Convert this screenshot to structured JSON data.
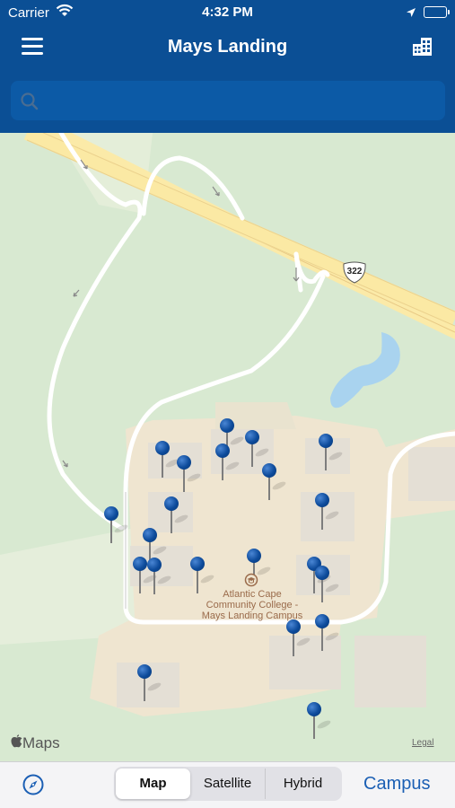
{
  "status_bar": {
    "carrier": "Carrier",
    "time": "4:32 PM",
    "icons": [
      "wifi-icon",
      "location-arrow-icon",
      "battery-icon"
    ]
  },
  "nav_bar": {
    "title": "Mays Landing",
    "left_icon": "hamburger-menu-icon",
    "right_icon": "building-icon"
  },
  "search": {
    "placeholder": "",
    "value": "",
    "icon": "search-icon"
  },
  "map": {
    "poi_label": "Atlantic Cape Community College - Mays Landing Campus",
    "route_shield": "322",
    "attribution": "Maps",
    "legal_link": "Legal",
    "pin_count": 22,
    "colors": {
      "land": "#d9ead3",
      "campus": "#f1e6d2",
      "highway": "#fbeaa8",
      "water": "#a9d3ef",
      "pin": "#0d4b9b"
    }
  },
  "bottom_bar": {
    "compass_icon": "compass-icon",
    "map_types": [
      {
        "label": "Map",
        "active": true
      },
      {
        "label": "Satellite",
        "active": false
      },
      {
        "label": "Hybrid",
        "active": false
      }
    ],
    "campus_button": "Campus"
  },
  "colors": {
    "brand_blue": "#0b4f95",
    "search_bg": "#0c5aa6",
    "link_blue": "#1b5fb4"
  }
}
